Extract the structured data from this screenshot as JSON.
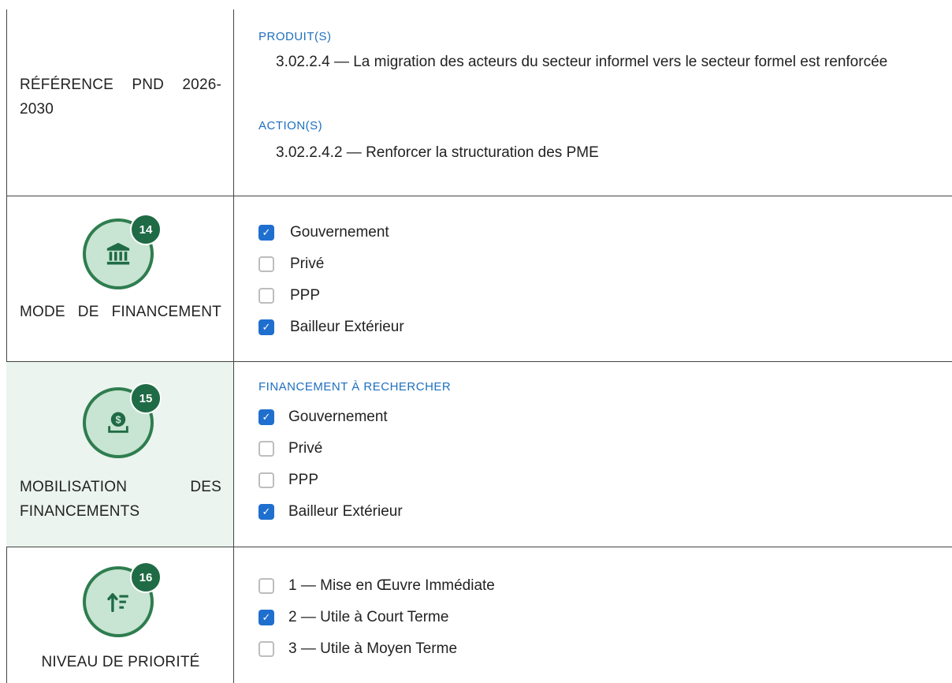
{
  "rows": {
    "reference": {
      "label": "RÉFÉRENCE PND 2026-2030",
      "produits_title": "PRODUIT(S)",
      "produit_text": "3.02.2.4 — La migration des acteurs du secteur informel vers le secteur formel est renforcée",
      "actions_title": "ACTION(S)",
      "action_text": "3.02.2.4.2 — Renforcer la structuration des PME"
    },
    "mode": {
      "label": "MODE DE FINANCEMENT",
      "badge": "14",
      "icon": "bank-icon",
      "options": [
        {
          "label": "Gouvernement",
          "checked": true
        },
        {
          "label": "Privé",
          "checked": false
        },
        {
          "label": "PPP",
          "checked": false
        },
        {
          "label": "Bailleur Extérieur",
          "checked": true
        }
      ]
    },
    "mobilisation": {
      "label": "MOBILISATION DES FINANCEMENTS",
      "badge": "15",
      "icon": "money-deposit-icon",
      "section_title": "FINANCEMENT À RECHERCHER",
      "options": [
        {
          "label": "Gouvernement",
          "checked": true
        },
        {
          "label": "Privé",
          "checked": false
        },
        {
          "label": "PPP",
          "checked": false
        },
        {
          "label": "Bailleur Extérieur",
          "checked": true
        }
      ]
    },
    "priorite": {
      "label": "NIVEAU DE PRIORITÉ",
      "badge": "16",
      "icon": "sort-priority-icon",
      "options": [
        {
          "label": "1 — Mise en Œuvre Immédiate",
          "checked": false
        },
        {
          "label": "2 — Utile à Court Terme",
          "checked": true
        },
        {
          "label": "3 — Utile à Moyen Terme",
          "checked": false
        }
      ]
    }
  },
  "colors": {
    "accent_blue": "#1f6fcf",
    "badge_green": "#1f6b45",
    "circle_fill": "#c8e4d2"
  }
}
